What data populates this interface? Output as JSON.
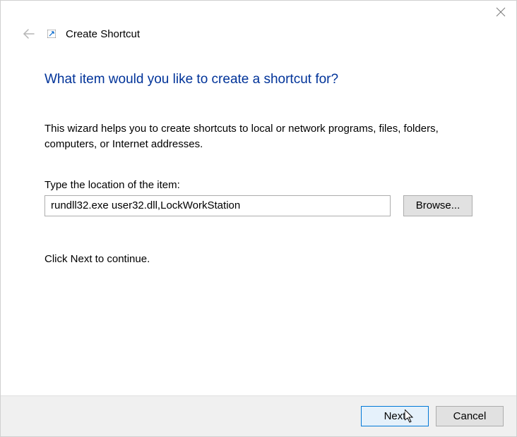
{
  "dialog": {
    "title": "Create Shortcut"
  },
  "content": {
    "heading": "What item would you like to create a shortcut for?",
    "description": "This wizard helps you to create shortcuts to local or network programs, files, folders, computers, or Internet addresses.",
    "location_label": "Type the location of the item:",
    "location_value": "rundll32.exe user32.dll,LockWorkStation",
    "browse_label": "Browse...",
    "continue_text": "Click Next to continue."
  },
  "footer": {
    "next_label": "Next",
    "cancel_label": "Cancel"
  }
}
